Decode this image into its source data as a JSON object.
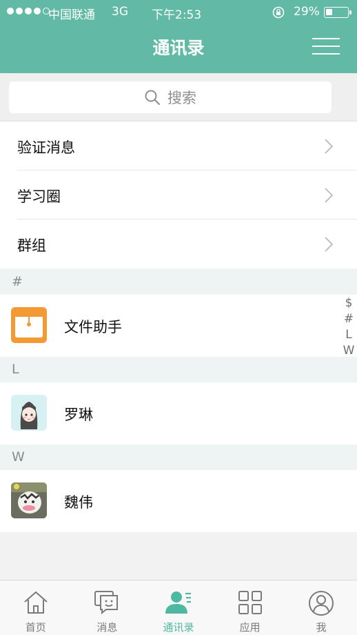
{
  "status_bar": {
    "carrier": "中国联通",
    "network": "3G",
    "time": "下午2:53",
    "battery": "29%",
    "battery_level": 0.29
  },
  "nav": {
    "title": "通讯录"
  },
  "search": {
    "placeholder": "搜索"
  },
  "menu": [
    {
      "label": "验证消息"
    },
    {
      "label": "学习圈"
    },
    {
      "label": "群组"
    }
  ],
  "sections": [
    {
      "letter": "#",
      "contacts": [
        {
          "name": "文件助手",
          "avatar": "folder-icon"
        }
      ]
    },
    {
      "letter": "L",
      "contacts": [
        {
          "name": "罗琳",
          "avatar": "girl-avatar"
        }
      ]
    },
    {
      "letter": "W",
      "contacts": [
        {
          "name": "魏伟",
          "avatar": "photo-avatar"
        }
      ]
    }
  ],
  "index": [
    "$",
    "#",
    "L",
    "W"
  ],
  "tabs": [
    {
      "label": "首页",
      "icon": "home-icon"
    },
    {
      "label": "消息",
      "icon": "chat-icon"
    },
    {
      "label": "通讯录",
      "icon": "contacts-icon",
      "active": true
    },
    {
      "label": "应用",
      "icon": "grid-icon"
    },
    {
      "label": "我",
      "icon": "profile-icon"
    }
  ],
  "colors": {
    "accent": "#62baa6",
    "folder_orange": "#f39a35"
  }
}
